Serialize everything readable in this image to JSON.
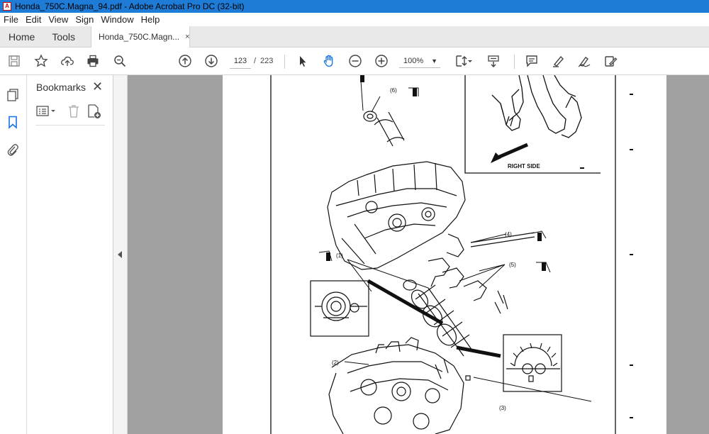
{
  "window": {
    "title": "Honda_750C.Magna_94.pdf - Adobe Acrobat Pro DC (32-bit)",
    "app_icon": "pdf-icon"
  },
  "menu": [
    "File",
    "Edit",
    "View",
    "Sign",
    "Window",
    "Help"
  ],
  "tabs": {
    "home": "Home",
    "tools": "Tools",
    "document": "Honda_750C.Magn...",
    "close_glyph": "×"
  },
  "toolbar": {
    "current_page": "123",
    "page_separator": "/",
    "total_pages": "223",
    "zoom": "100%"
  },
  "bookmarks": {
    "title": "Bookmarks",
    "close_glyph": "✕"
  },
  "diagram": {
    "labels": {
      "l1": "(1)",
      "l2": "(2)",
      "l3": "(3)",
      "l4": "(4)",
      "l5": "(5)",
      "l6": "(6)",
      "right_side": "RIGHT SIDE"
    }
  },
  "colors": {
    "titlebar": "#1e7bd6",
    "viewer_bg": "#a0a0a0",
    "accent_blue": "#1473e6"
  }
}
